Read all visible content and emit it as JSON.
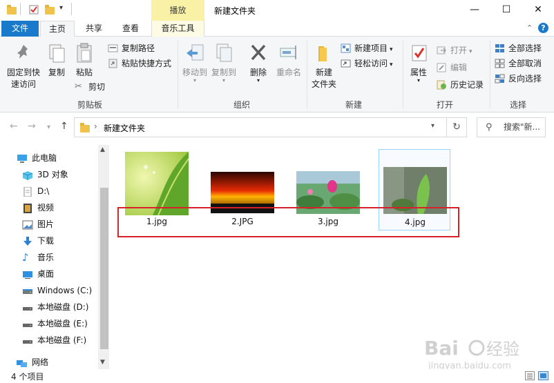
{
  "window": {
    "title": "新建文件夹",
    "context_tab_header": "播放",
    "controls": {
      "minimize": "—",
      "maximize": "☐",
      "close": "✕"
    }
  },
  "tabs": {
    "file": "文件",
    "home": "主页",
    "share": "共享",
    "view": "查看",
    "music_tools": "音乐工具"
  },
  "ribbon": {
    "clipboard": {
      "label": "剪贴板",
      "pin_line1": "固定到快",
      "pin_line2": "速访问",
      "copy": "复制",
      "paste": "粘贴",
      "copy_path": "复制路径",
      "paste_shortcut": "粘贴快捷方式",
      "cut": "剪切"
    },
    "organize": {
      "label": "组织",
      "move_to": "移动到",
      "copy_to": "复制到",
      "delete": "删除",
      "rename": "重命名"
    },
    "new": {
      "label": "新建",
      "new_folder_line1": "新建",
      "new_folder_line2": "文件夹",
      "new_item": "新建项目",
      "easy_access": "轻松访问"
    },
    "open": {
      "label": "打开",
      "properties": "属性",
      "open": "打开",
      "edit": "编辑",
      "history": "历史记录"
    },
    "select": {
      "label": "选择",
      "select_all": "全部选择",
      "select_none": "全部取消",
      "invert": "反向选择"
    }
  },
  "address": {
    "path": "新建文件夹",
    "search_placeholder": "搜索\"新..."
  },
  "nav": {
    "items": [
      {
        "label": "此电脑",
        "icon": "pc-icon"
      },
      {
        "label": "3D 对象",
        "icon": "cube-icon"
      },
      {
        "label": "D:\\",
        "icon": "document-icon"
      },
      {
        "label": "视频",
        "icon": "video-icon"
      },
      {
        "label": "图片",
        "icon": "picture-icon"
      },
      {
        "label": "下载",
        "icon": "download-icon"
      },
      {
        "label": "音乐",
        "icon": "music-icon"
      },
      {
        "label": "桌面",
        "icon": "desktop-icon"
      },
      {
        "label": "Windows (C:)",
        "icon": "drive-icon"
      },
      {
        "label": "本地磁盘 (D:)",
        "icon": "drive-icon"
      },
      {
        "label": "本地磁盘 (E:)",
        "icon": "drive-icon"
      },
      {
        "label": "本地磁盘 (F:)",
        "icon": "drive-icon"
      },
      {
        "label": "网络",
        "icon": "network-icon"
      }
    ]
  },
  "files": [
    {
      "name": "1.jpg"
    },
    {
      "name": "2.JPG"
    },
    {
      "name": "3.jpg"
    },
    {
      "name": "4.jpg"
    }
  ],
  "status": {
    "count": "4 个项目"
  },
  "watermark": {
    "text": "Baidu经验",
    "url": "jingyan.baidu.com"
  },
  "colors": {
    "accent": "#1979ca",
    "highlight": "#d8202a",
    "context_tab": "#f9f1a5"
  }
}
